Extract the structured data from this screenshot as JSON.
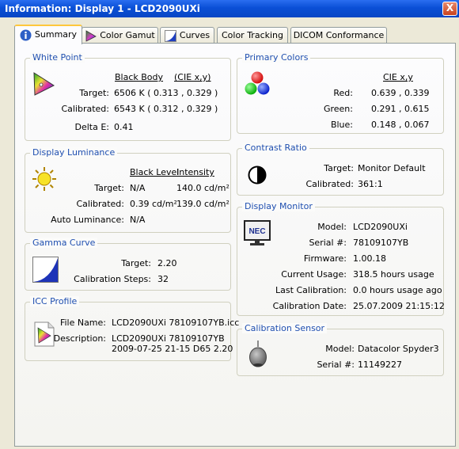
{
  "window": {
    "title": "Information: Display 1 - LCD2090UXi",
    "close_label": "X"
  },
  "tabs": [
    {
      "label": "Summary",
      "icon": "info-icon",
      "active": true
    },
    {
      "label": "Color Gamut",
      "icon": "color-gamut-icon"
    },
    {
      "label": "Curves",
      "icon": "curves-icon"
    },
    {
      "label": "Color Tracking",
      "icon": ""
    },
    {
      "label": "DICOM Conformance",
      "icon": ""
    }
  ],
  "white_point": {
    "title": "White Point",
    "col1_header": "Black Body",
    "col2_header": "(CIE x,y)",
    "target_label": "Target:",
    "target_value": "6506 K  ( 0.313 , 0.329 )",
    "calibrated_label": "Calibrated:",
    "calibrated_value": "6543 K  ( 0.312 , 0.329 )",
    "delta_label": "Delta E:",
    "delta_value": "0.41"
  },
  "display_luminance": {
    "title": "Display Luminance",
    "col1_header": "Black Level",
    "col2_header": "Intensity",
    "target_label": "Target:",
    "target_black": "N/A",
    "target_intensity": "140.0 cd/m²",
    "calibrated_label": "Calibrated:",
    "calibrated_black": "0.39 cd/m²",
    "calibrated_intensity": "139.0 cd/m²",
    "auto_label": "Auto Luminance:",
    "auto_value": "N/A"
  },
  "gamma_curve": {
    "title": "Gamma Curve",
    "target_label": "Target:",
    "target_value": "2.20",
    "steps_label": "Calibration Steps:",
    "steps_value": "32"
  },
  "icc_profile": {
    "title": "ICC Profile",
    "file_label": "File Name:",
    "file_value": "LCD2090UXi 78109107YB.icc",
    "desc_label": "Description:",
    "desc_line1": "LCD2090UXi 78109107YB",
    "desc_line2": "2009-07-25 21-15 D65 2.20"
  },
  "primary_colors": {
    "title": "Primary Colors",
    "header": "CIE x,y",
    "red_label": "Red:",
    "red_value": "0.639 , 0.339",
    "green_label": "Green:",
    "green_value": "0.291 , 0.615",
    "blue_label": "Blue:",
    "blue_value": "0.148 , 0.067"
  },
  "contrast_ratio": {
    "title": "Contrast Ratio",
    "target_label": "Target:",
    "target_value": "Monitor Default",
    "calibrated_label": "Calibrated:",
    "calibrated_value": "361:1"
  },
  "display_monitor": {
    "title": "Display Monitor",
    "brand_logo": "NEC",
    "model_label": "Model:",
    "model_value": "LCD2090UXi",
    "serial_label": "Serial #:",
    "serial_value": "78109107YB",
    "firmware_label": "Firmware:",
    "firmware_value": "1.00.18",
    "usage_label": "Current Usage:",
    "usage_value": "318.5 hours usage",
    "last_cal_label": "Last Calibration:",
    "last_cal_value": "0.0 hours usage ago",
    "cal_date_label": "Calibration Date:",
    "cal_date_value": "25.07.2009 21:15:12"
  },
  "calibration_sensor": {
    "title": "Calibration Sensor",
    "model_label": "Model:",
    "model_value": "Datacolor Spyder3",
    "serial_label": "Serial #:",
    "serial_value": "11149227"
  },
  "colors": {
    "title_bar": "#0a4fd6",
    "group_title": "#1f4fb0",
    "tab_highlight": "#ffc73c"
  }
}
